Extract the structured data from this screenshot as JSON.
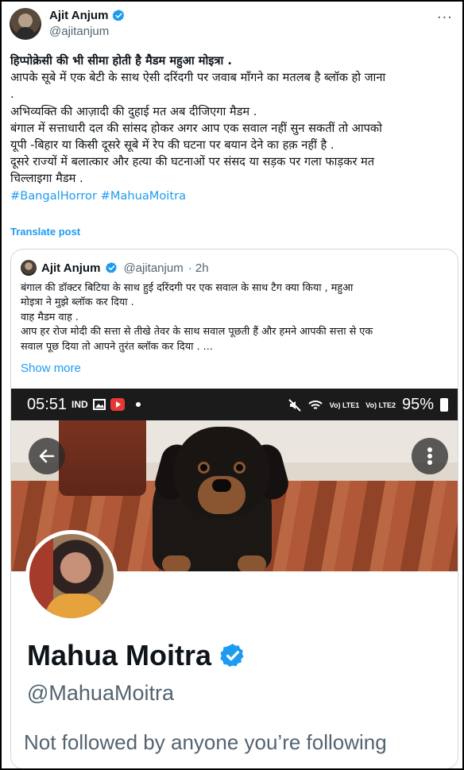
{
  "author": {
    "name": "Ajit Anjum",
    "handle": "@ajitanjum"
  },
  "more_glyph": "···",
  "tweet": {
    "lines": [
      "हिप्पोक्रेसी की भी सीमा होती है मैडम महुआ मोइत्रा .",
      "आपके सूबे में एक बेटी के साथ ऐसी दरिंदगी पर जवाब माँगने का मतलब है ब्लॉक हो जाना",
      ".",
      "अभिव्यक्ति की आज़ादी की दुहाई मत अब दीजिएगा मैडम .",
      "बंगाल में सत्ताधारी दल की सांसद होकर अगर आप एक सवाल नहीं सुन सकतीं तो आपको",
      "यूपी -बिहार या किसी दूसरे सूबे में रेप की घटना पर बयान देने का हक़ नहीं है .",
      "दूसरे राज्यों में बलात्कार और हत्या की घटनाओं पर संसद या सड़क पर गला फाड़कर मत",
      "चिल्लाइगा मैडम ."
    ],
    "hashtags": "#BangalHorror #MahuaMoitra",
    "translate_label": "Translate post"
  },
  "quote": {
    "name": "Ajit Anjum",
    "handle": "@ajitanjum",
    "time": "· 2h",
    "lines": [
      "बंगाल की डॉक्टर बिटिया के साथ हुई दरिंदगी पर एक सवाल के साथ टैग क्या किया , महुआ",
      "मोइत्रा ने मुझे ब्लॉक कर दिया .",
      "वाह मैडम वाह .",
      "आप हर रोज मोदी की सत्ता से तीखे तेवर के साथ सवाल पूछती हैं और हमने आपकी सत्ता से एक",
      "सवाल पूछ दिया तो आपने तुरंत ब्लॉक कर दिया . ..."
    ],
    "show_more": "Show more"
  },
  "screenshot": {
    "status_time": "05:51",
    "status_net": "IND",
    "signal_1": "Vo) LTE1",
    "signal_2": "Vo) LTE2",
    "battery": "95%",
    "profile_name": "Mahua Moitra",
    "profile_handle": "@MahuaMoitra",
    "follow_note": "Not followed by anyone you’re following"
  },
  "colors": {
    "accent": "#1d9bf0",
    "secondary_text": "#536471",
    "verified": "#1d9bf0"
  }
}
